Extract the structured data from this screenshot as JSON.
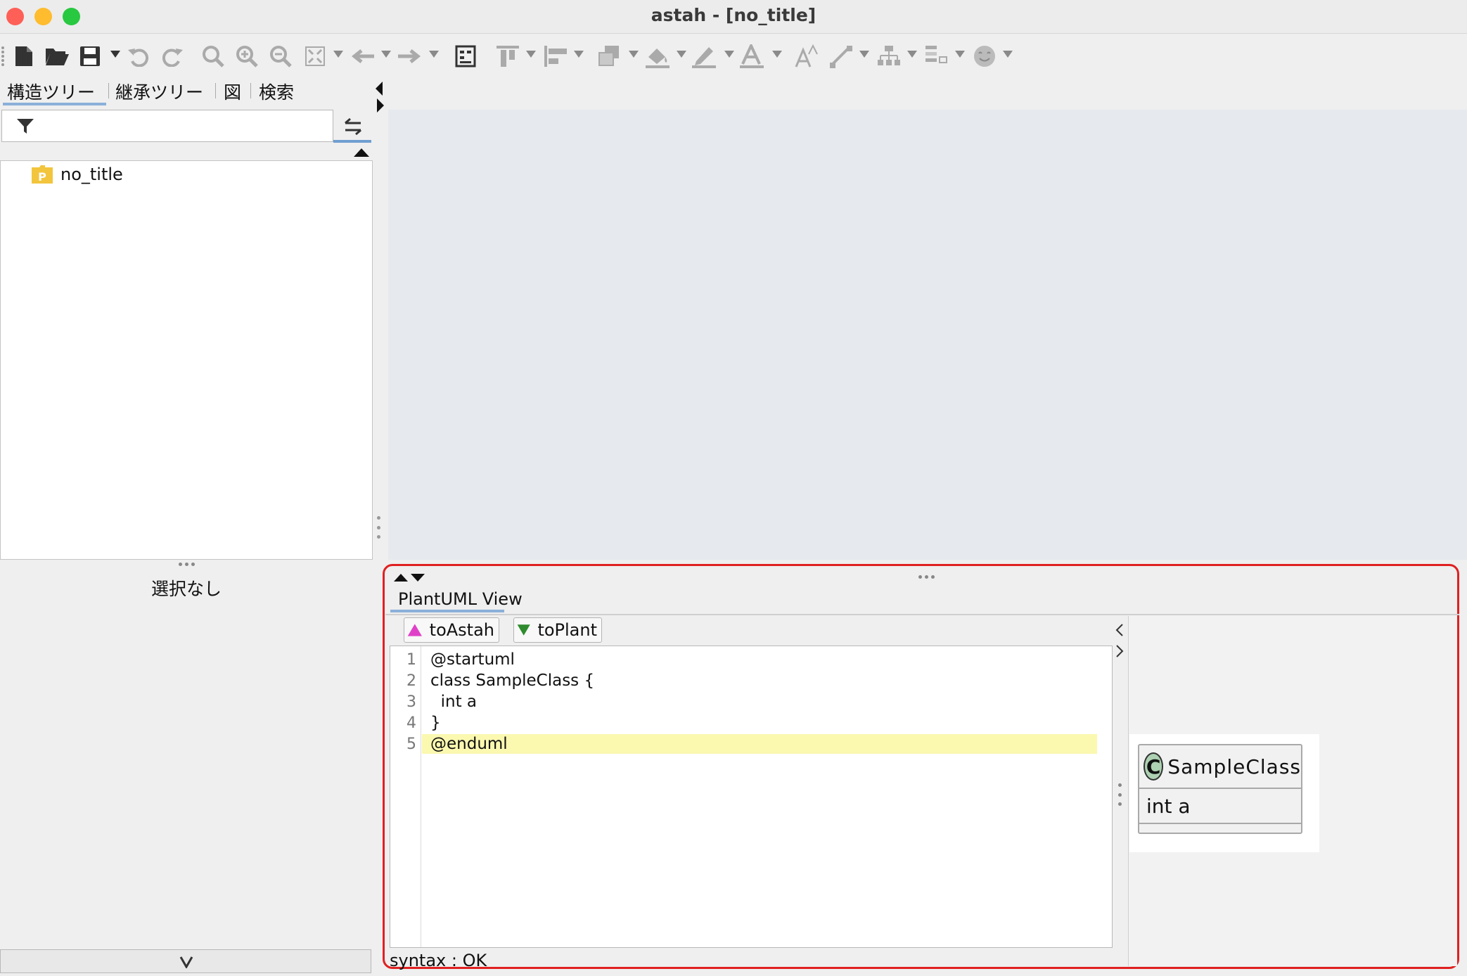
{
  "window": {
    "title": "astah - [no_title]"
  },
  "left_panel": {
    "tabs": [
      "構造ツリー",
      "継承ツリー",
      "図",
      "検索"
    ],
    "active_tab": 0,
    "filter_placeholder": "",
    "tree": {
      "root_badge": "P",
      "root_label": "no_title"
    },
    "property_status": "選択なし"
  },
  "plantuml_view": {
    "tab_title": "PlantUML View",
    "buttons": {
      "to_astah": "toAstah",
      "to_plant": "toPlant"
    },
    "editor": {
      "line_numbers": [
        "1",
        "2",
        "3",
        "4",
        "5"
      ],
      "lines": [
        "@startuml",
        "class SampleClass {",
        "  int a",
        "}",
        "@enduml"
      ],
      "highlighted_line": 5
    },
    "syntax_status": "syntax : OK",
    "preview": {
      "class_badge": "C",
      "class_name": "SampleClass",
      "attribute": "int a"
    }
  },
  "colors": {
    "highlight_border": "#e02020",
    "diagram_background": "#e6e9ed",
    "current_line": "#fbf8b0",
    "to_astah_icon": "#e040c8",
    "to_plant_icon": "#2e8b2e",
    "class_badge": "#add1b2",
    "package_icon": "#f2c53d",
    "tab_underline": "#8ab0d8"
  }
}
